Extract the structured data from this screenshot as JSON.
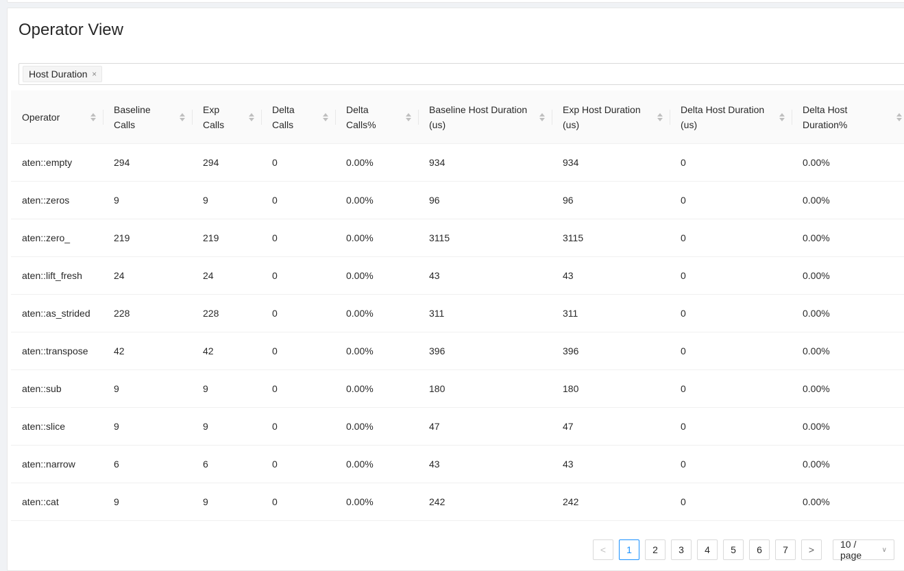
{
  "page": {
    "title": "Operator View"
  },
  "filter": {
    "tags": [
      {
        "label": "Host Duration",
        "close": "×"
      }
    ]
  },
  "table": {
    "columns": [
      {
        "line1": "Operator",
        "line2": ""
      },
      {
        "line1": "Baseline",
        "line2": "Calls"
      },
      {
        "line1": "Exp",
        "line2": "Calls"
      },
      {
        "line1": "Delta",
        "line2": "Calls"
      },
      {
        "line1": "Delta",
        "line2": "Calls%"
      },
      {
        "line1": "Baseline Host Duration",
        "line2": "(us)"
      },
      {
        "line1": "Exp Host Duration",
        "line2": "(us)"
      },
      {
        "line1": "Delta Host Duration",
        "line2": "(us)"
      },
      {
        "line1": "Delta Host",
        "line2": "Duration%"
      }
    ],
    "rows": [
      [
        "aten::empty",
        "294",
        "294",
        "0",
        "0.00%",
        "934",
        "934",
        "0",
        "0.00%"
      ],
      [
        "aten::zeros",
        "9",
        "9",
        "0",
        "0.00%",
        "96",
        "96",
        "0",
        "0.00%"
      ],
      [
        "aten::zero_",
        "219",
        "219",
        "0",
        "0.00%",
        "3115",
        "3115",
        "0",
        "0.00%"
      ],
      [
        "aten::lift_fresh",
        "24",
        "24",
        "0",
        "0.00%",
        "43",
        "43",
        "0",
        "0.00%"
      ],
      [
        "aten::as_strided",
        "228",
        "228",
        "0",
        "0.00%",
        "311",
        "311",
        "0",
        "0.00%"
      ],
      [
        "aten::transpose",
        "42",
        "42",
        "0",
        "0.00%",
        "396",
        "396",
        "0",
        "0.00%"
      ],
      [
        "aten::sub",
        "9",
        "9",
        "0",
        "0.00%",
        "180",
        "180",
        "0",
        "0.00%"
      ],
      [
        "aten::slice",
        "9",
        "9",
        "0",
        "0.00%",
        "47",
        "47",
        "0",
        "0.00%"
      ],
      [
        "aten::narrow",
        "6",
        "6",
        "0",
        "0.00%",
        "43",
        "43",
        "0",
        "0.00%"
      ],
      [
        "aten::cat",
        "9",
        "9",
        "0",
        "0.00%",
        "242",
        "242",
        "0",
        "0.00%"
      ]
    ]
  },
  "pagination": {
    "prev": "<",
    "pages": [
      "1",
      "2",
      "3",
      "4",
      "5",
      "6",
      "7"
    ],
    "current": "1",
    "next": ">",
    "page_size": "10 / page"
  },
  "colors": {
    "accent": "#1890ff",
    "header_bg": "#fafafa",
    "border": "#f0f0f0"
  }
}
